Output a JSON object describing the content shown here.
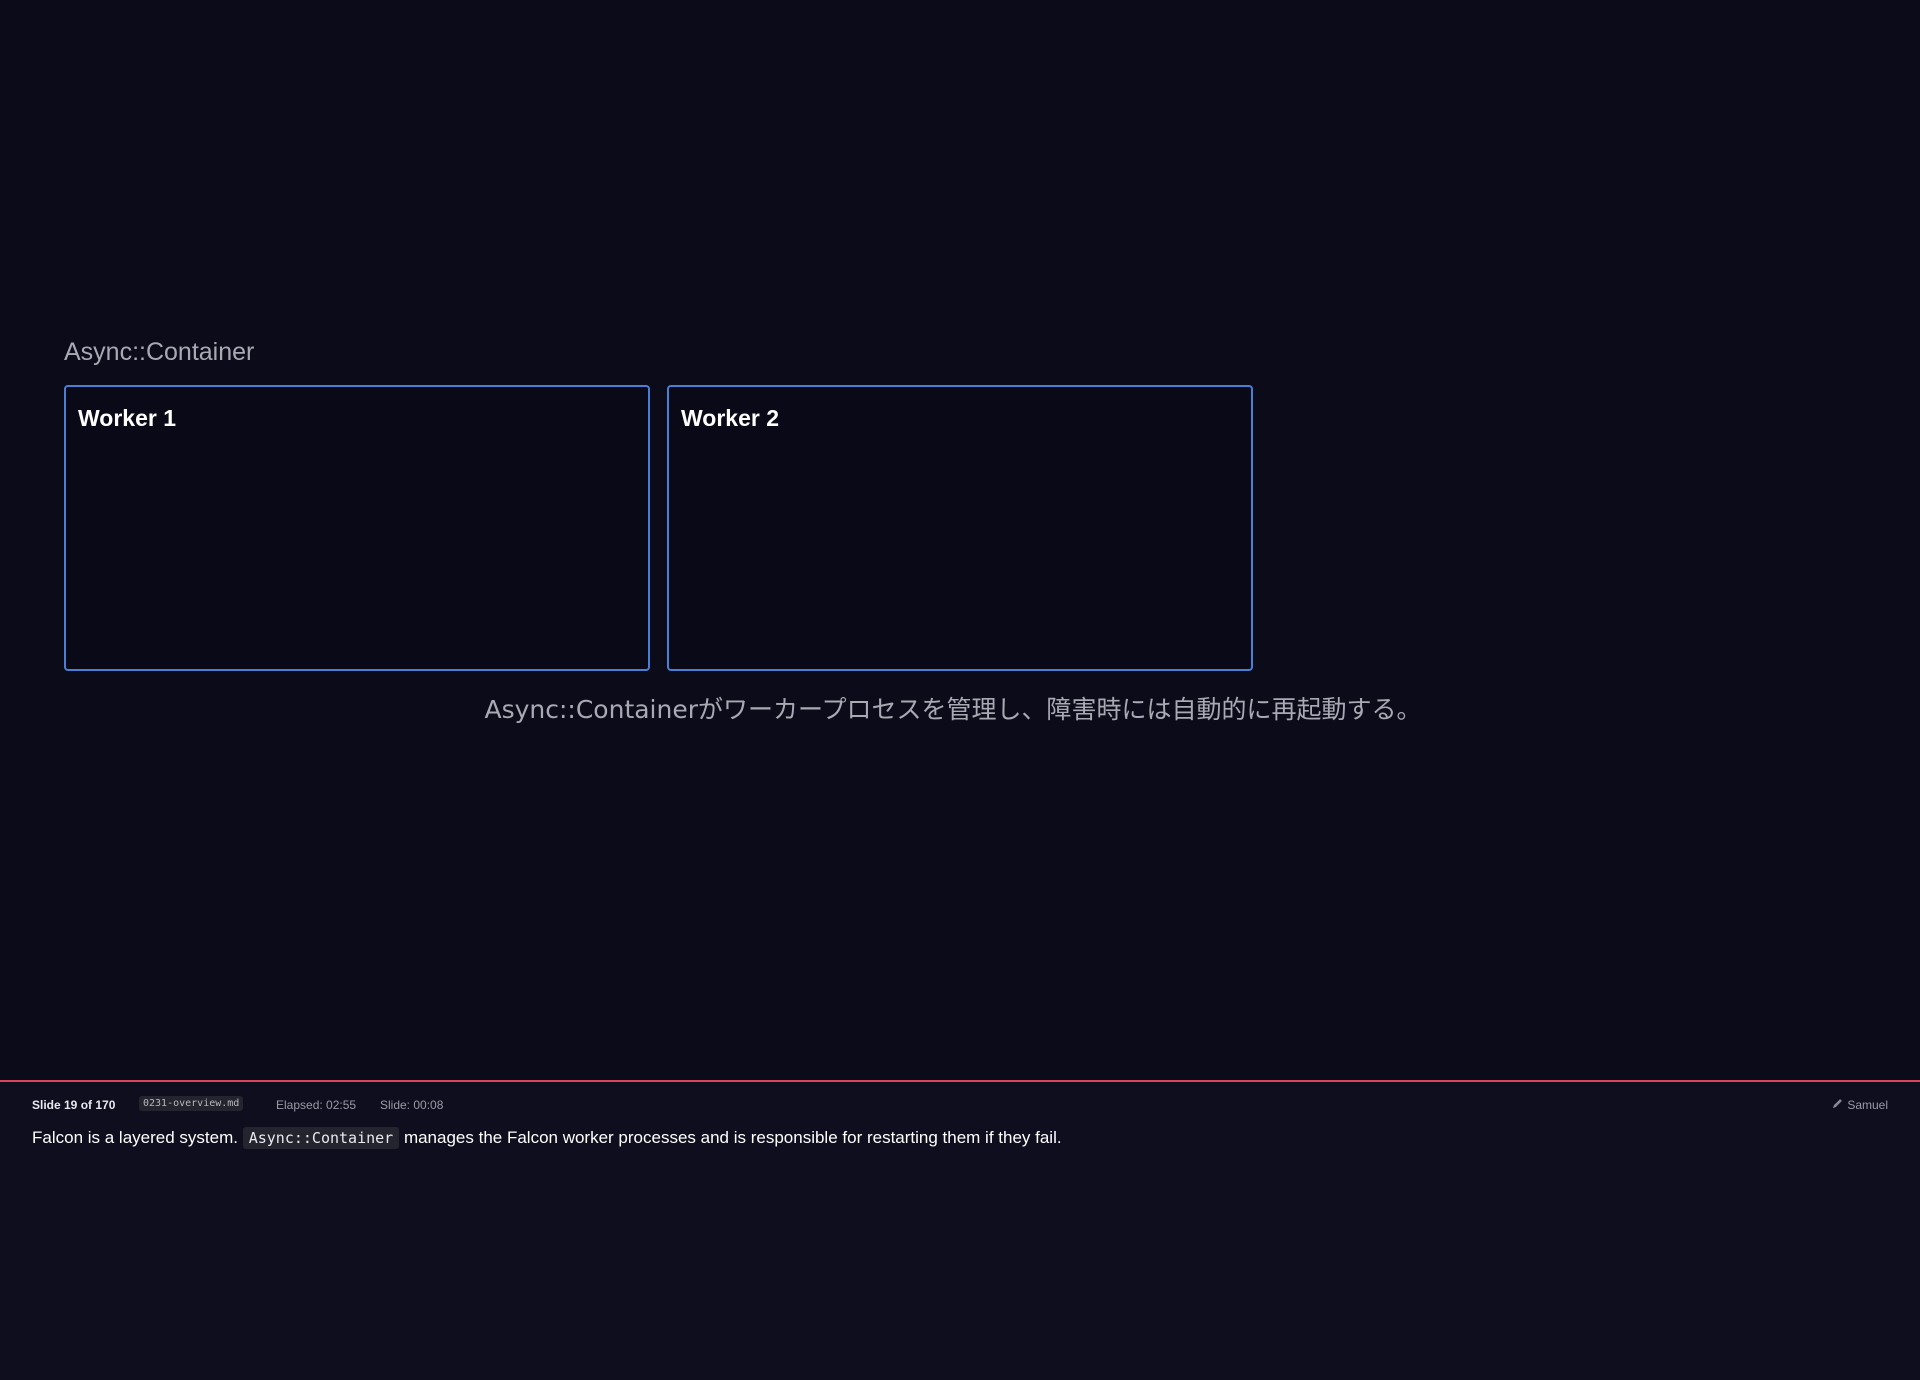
{
  "slide": {
    "container_label": "Async::Container",
    "workers": [
      {
        "title": "Worker 1"
      },
      {
        "title": "Worker 2"
      }
    ],
    "caption": "Async::Containerがワーカープロセスを管理し、障害時には自動的に再起動する。"
  },
  "notes": {
    "slide_count": "Slide 19 of 170",
    "filename": "0231-overview.md",
    "elapsed": "Elapsed: 02:55",
    "slide_time": "Slide: 00:08",
    "presenter_icon": "pen-icon",
    "presenter": "Samuel",
    "text_before": "Falcon is a layered system.",
    "code": "Async::Container",
    "text_after": "manages the Falcon worker processes and is responsible for restarting them if they fail."
  },
  "colors": {
    "background": "#0b0b1a",
    "worker_border": "#4a7fd6",
    "notes_divider": "#d6445e"
  }
}
